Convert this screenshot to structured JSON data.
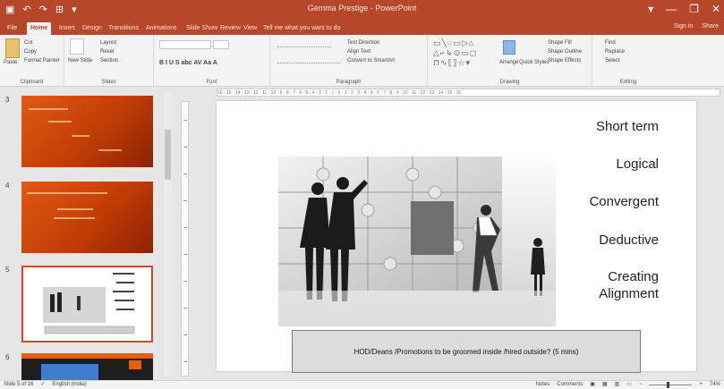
{
  "window": {
    "title": "Gemma Prestige - PowerPoint",
    "controls": [
      "▾",
      "—",
      "❐",
      "✕"
    ]
  },
  "qat": {
    "items": [
      "▣",
      "↶",
      "↷",
      "⊞",
      "▾"
    ]
  },
  "tabs": [
    {
      "label": "File"
    },
    {
      "label": "Home"
    },
    {
      "label": "Insert"
    },
    {
      "label": "Design"
    },
    {
      "label": "Transitions"
    },
    {
      "label": "Animations"
    },
    {
      "label": "Slide Show"
    },
    {
      "label": "Review"
    },
    {
      "label": "View"
    },
    {
      "label": "Tell me what you want to do"
    }
  ],
  "account": {
    "sign_in": "Sign in",
    "share": "Share"
  },
  "ribbon": {
    "clipboard": {
      "label": "Clipboard",
      "paste": "Paste",
      "cut": "Cut",
      "copy": "Copy",
      "format_painter": "Format Painter"
    },
    "slides": {
      "label": "Slides",
      "new_slide": "New Slide",
      "layout": "Layout",
      "reset": "Reset",
      "section": "Section"
    },
    "font": {
      "label": "Font",
      "buttons": "B  I  U  S  abc  AV  Aa  A"
    },
    "paragraph": {
      "label": "Paragraph",
      "text_direction": "Text Direction",
      "align_text": "Align Text",
      "smartart": "Convert to SmartArt"
    },
    "drawing": {
      "label": "Drawing",
      "arrange": "Arrange",
      "quick_styles": "Quick Styles",
      "shape_fill": "Shape Fill",
      "shape_outline": "Shape Outline",
      "shape_effects": "Shape Effects"
    },
    "editing": {
      "label": "Editing",
      "find": "Find",
      "replace": "Replace",
      "select": "Select"
    }
  },
  "thumbnails": [
    {
      "number": "3",
      "style": "orange"
    },
    {
      "number": "4",
      "style": "orange"
    },
    {
      "number": "5",
      "style": "selected"
    },
    {
      "number": "6",
      "style": "partial"
    }
  ],
  "ruler": {
    "ticks": "16 · 15 · 14 · 13 · 12 · 11 · 10 · 9 · 8 · 7 · 6 · 5 · 4 · 3 · 2 · 1 · 0 · 1 · 2 · 3 · 4 · 5 · 6 · 7 · 8 · 9 · 10 · 11 · 12 · 13 · 14 · 15 · 16"
  },
  "slide": {
    "keywords": [
      "Short term",
      "Logical",
      "Convergent",
      "Deductive",
      "Creating",
      "Alignment"
    ],
    "question": "HOD/Deans /Promotions  to be groomed inside /hired outside? (5 mins)"
  },
  "status": {
    "slide_info": "Slide 5 of 16",
    "language": "English (India)",
    "notes": "Notes",
    "comments": "Comments",
    "zoom": "74%"
  },
  "colors": {
    "accent": "#b7472a",
    "thumb_orange": "#d0500e"
  }
}
